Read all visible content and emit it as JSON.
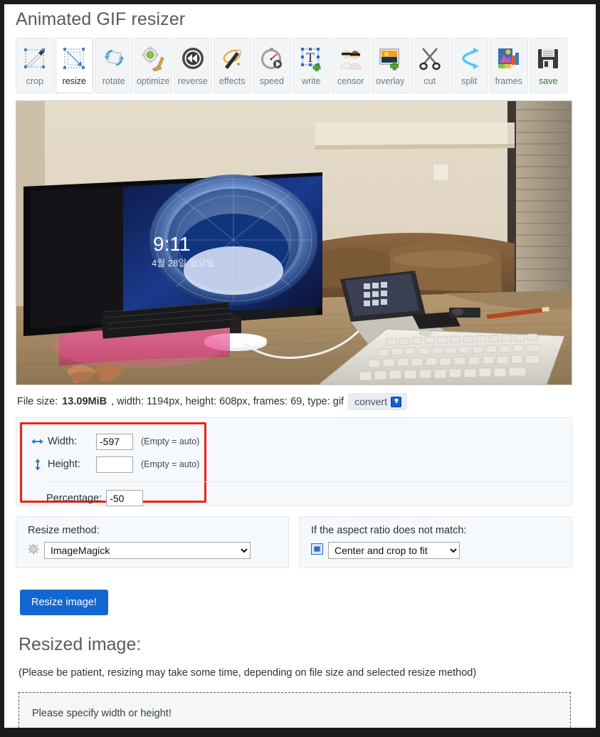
{
  "page": {
    "title": "Animated GIF resizer"
  },
  "toolbar": {
    "items": [
      {
        "label": "crop",
        "icon": "crop-icon",
        "active": false
      },
      {
        "label": "resize",
        "icon": "resize-icon",
        "active": true
      },
      {
        "label": "rotate",
        "icon": "rotate-icon",
        "active": false
      },
      {
        "label": "optimize",
        "icon": "optimize-icon",
        "active": false
      },
      {
        "label": "reverse",
        "icon": "reverse-icon",
        "active": false
      },
      {
        "label": "effects",
        "icon": "effects-icon",
        "active": false
      },
      {
        "label": "speed",
        "icon": "speed-icon",
        "active": false
      },
      {
        "label": "write",
        "icon": "write-icon",
        "active": false
      },
      {
        "label": "censor",
        "icon": "censor-icon",
        "active": false
      },
      {
        "label": "overlay",
        "icon": "overlay-icon",
        "active": false
      },
      {
        "label": "cut",
        "icon": "cut-icon",
        "active": false
      },
      {
        "label": "split",
        "icon": "split-icon",
        "active": false
      },
      {
        "label": "frames",
        "icon": "frames-icon",
        "active": false
      },
      {
        "label": "save",
        "icon": "save-icon",
        "active": false
      }
    ]
  },
  "preview": {
    "alt": "animated gif preview of a desk with monitor, keyboard and mouse",
    "screen_clock": "9:11",
    "screen_date": "4월 28일 일요일"
  },
  "fileinfo": {
    "prefix": "File size:",
    "size": "13.09MiB",
    "rest": ", width: 1194px, height: 608px, frames: 69, type: gif",
    "convert_label": "convert"
  },
  "size_form": {
    "width_label": "Width:",
    "width_value": "-597",
    "width_hint": "(Empty = auto)",
    "height_label": "Height:",
    "height_value": "",
    "height_placeholder": "",
    "height_hint": "(Empty = auto)",
    "percentage_label": "Percentage:",
    "percentage_value": "-50",
    "highlight_color": "#ef2211"
  },
  "options": {
    "resize_method_label": "Resize method:",
    "resize_method_value": "ImageMagick",
    "aspect_label": "If the aspect ratio does not match:",
    "aspect_value": "Center and crop to fit"
  },
  "actions": {
    "resize_button": "Resize image!",
    "primary_color": "#1366cf"
  },
  "result": {
    "title": "Resized image:",
    "note": "(Please be patient, resizing may take some time, depending on file size and selected resize method)",
    "message": "Please specify width or height!"
  }
}
